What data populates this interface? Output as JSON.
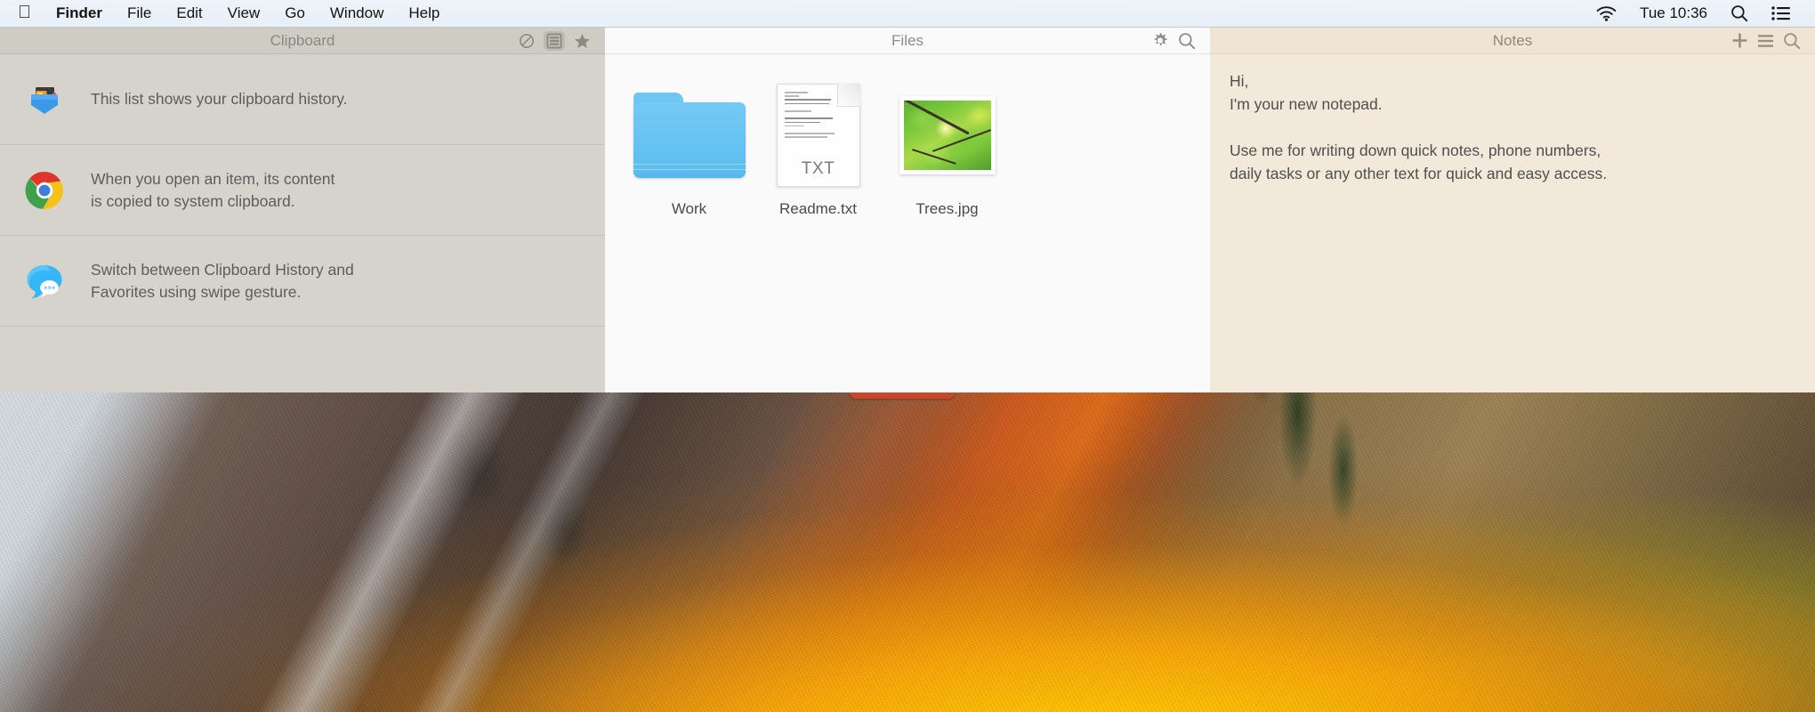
{
  "menubar": {
    "apple_glyph": "apple-logo",
    "items": [
      {
        "label": "Finder",
        "bold": true
      },
      {
        "label": "File",
        "bold": false
      },
      {
        "label": "Edit",
        "bold": false
      },
      {
        "label": "View",
        "bold": false
      },
      {
        "label": "Go",
        "bold": false
      },
      {
        "label": "Window",
        "bold": false
      },
      {
        "label": "Help",
        "bold": false
      }
    ],
    "status": {
      "wifi_icon": "wifi-icon",
      "clock": "Tue 10:36",
      "search_icon": "search-icon",
      "control_center_icon": "control-center-icon"
    },
    "background": "#eaf1f8"
  },
  "clipboard": {
    "title": "Clipboard",
    "background": "#d6d3cc",
    "tools": [
      {
        "name": "clear-history-icon",
        "label": "Clear",
        "active": false
      },
      {
        "name": "history-list-icon",
        "label": "History",
        "active": true
      },
      {
        "name": "favorites-star-icon",
        "label": "Favorites",
        "active": false
      }
    ],
    "items": [
      {
        "icon": "pocket-wallet-icon",
        "text": "This list shows your clipboard history."
      },
      {
        "icon": "chrome-icon",
        "text": "When you open an item, its content\nis copied to system clipboard."
      },
      {
        "icon": "messages-icon",
        "text": "Switch between Clipboard History and\nFavorites using swipe gesture."
      }
    ]
  },
  "files": {
    "title": "Files",
    "background": "#fafafa",
    "tools": [
      {
        "name": "gear-icon",
        "label": "Settings"
      },
      {
        "name": "search-icon",
        "label": "Search"
      }
    ],
    "items": [
      {
        "name": "Work",
        "type": "folder",
        "icon": "blue-folder-icon"
      },
      {
        "name": "Readme.txt",
        "type": "text",
        "icon": "txt-document-icon",
        "extension": "TXT"
      },
      {
        "name": "Trees.jpg",
        "type": "image",
        "icon": "photo-thumbnail-icon"
      }
    ]
  },
  "notes": {
    "title": "Notes",
    "background": "#f3e9da",
    "tools": [
      {
        "name": "add-note-icon",
        "label": "New Note"
      },
      {
        "name": "note-list-icon",
        "label": "List"
      },
      {
        "name": "search-icon",
        "label": "Search"
      }
    ],
    "content": "Hi,\nI'm your new notepad.\n\nUse me for writing down quick notes, phone numbers,\ndaily tasks or any other text for quick and easy access."
  },
  "desktop": {
    "wallpaper": "macos-high-sierra-mountain",
    "accent_tab_color": "#c7492c"
  }
}
